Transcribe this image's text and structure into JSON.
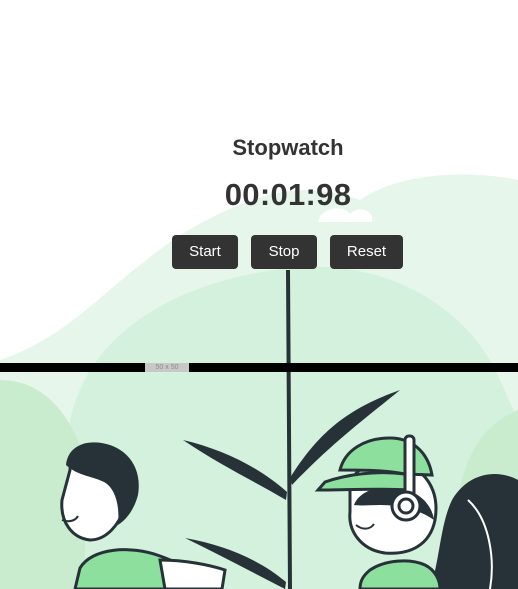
{
  "stopwatch": {
    "title": "Stopwatch",
    "time": "00:01:98",
    "buttons": {
      "start": "Start",
      "stop": "Stop",
      "reset": "Reset"
    }
  },
  "ad": {
    "placeholder": "50 x 50"
  },
  "colors": {
    "text": "#333333",
    "button_bg": "#333333",
    "button_text": "#ffffff",
    "illustration_light": "#d4f1de",
    "illustration_mid": "#8ddf9e",
    "illustration_dark": "#263238"
  }
}
